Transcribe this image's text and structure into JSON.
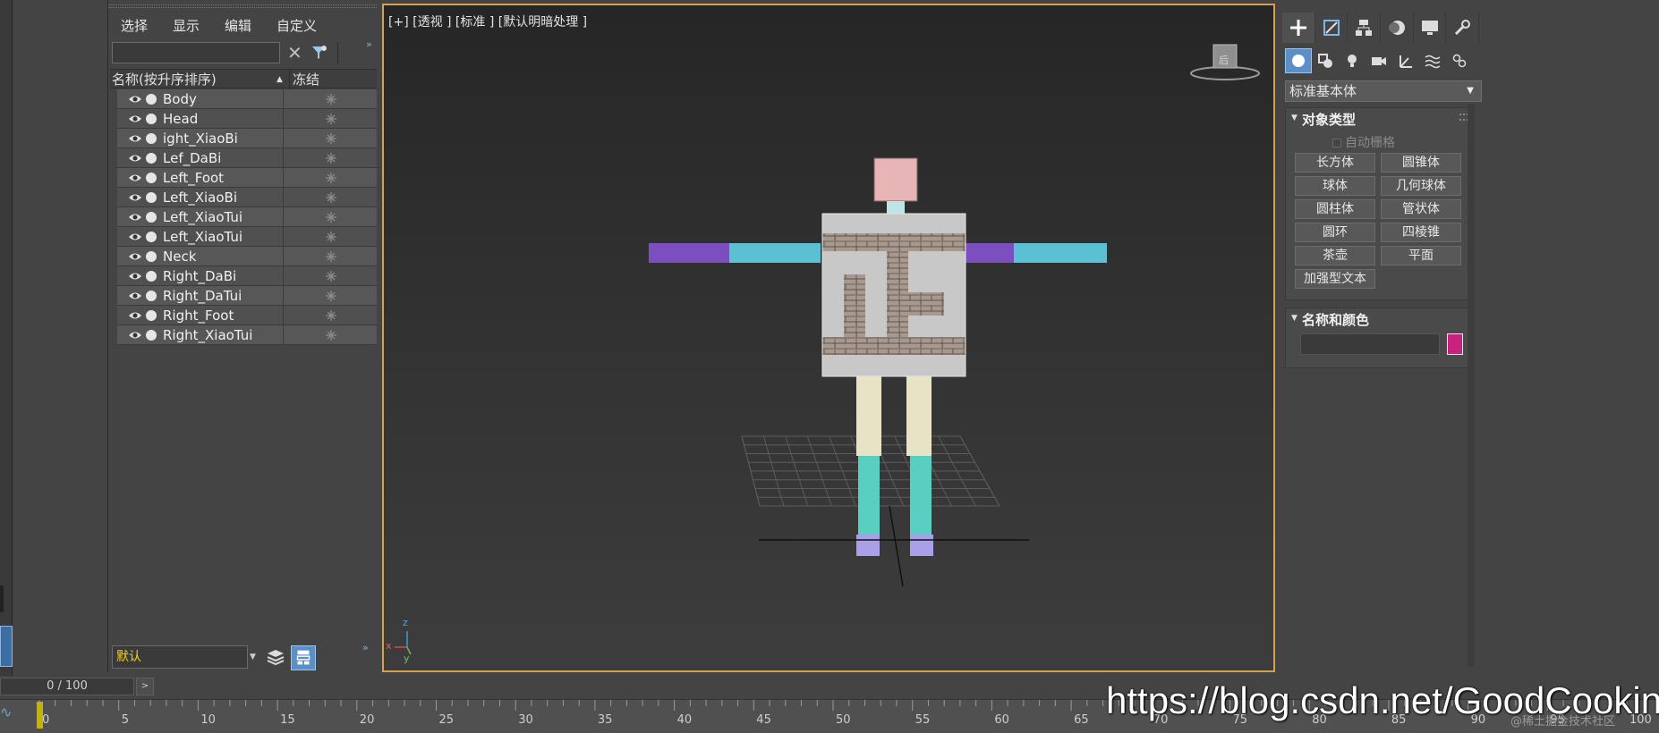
{
  "explorer": {
    "menu": [
      "选择",
      "显示",
      "编辑",
      "自定义"
    ],
    "search_placeholder": "",
    "column_name": "名称(按升序排序)",
    "column_sort": "▲",
    "column_freeze": "冻结",
    "objects": [
      "Body",
      "Head",
      "ight_XiaoBi",
      "Lef_DaBi",
      "Left_Foot",
      "Left_XiaoBi",
      "Left_XiaoTui",
      "Left_XiaoTui",
      "Neck",
      "Right_DaBi",
      "Right_DaTui",
      "Right_Foot",
      "Right_XiaoTui"
    ],
    "layer": "默认"
  },
  "viewport": {
    "label": "[+] [透视 ] [标准 ] [默认明暗处理 ]",
    "viewcube_face": "后",
    "axis_labels": {
      "x": "x",
      "y": "y",
      "z": "z"
    }
  },
  "command_panel": {
    "tab_icons": [
      "plus-icon",
      "modify-icon",
      "hierarchy-icon",
      "motion-icon",
      "display-icon",
      "utilities-icon"
    ],
    "subtab_icons": [
      "geometry-icon",
      "shapes-icon",
      "lights-icon",
      "cameras-icon",
      "helpers-icon",
      "spacewarps-icon",
      "systems-icon"
    ],
    "category": "标准基本体",
    "object_type_title": "对象类型",
    "autogrid": "自动栅格",
    "object_buttons": [
      "长方体",
      "圆锥体",
      "球体",
      "几何球体",
      "圆柱体",
      "管状体",
      "圆环",
      "四棱锥",
      "茶壶",
      "平面",
      "加强型文本"
    ],
    "name_color_title": "名称和颜色",
    "name_value": "",
    "object_color": "#c8227f"
  },
  "timeline": {
    "frame_display": "0 / 100",
    "ticks": [
      "0",
      "5",
      "10",
      "15",
      "20",
      "25",
      "30",
      "35",
      "40",
      "45",
      "50",
      "55",
      "60",
      "65",
      "70",
      "75",
      "80",
      "85",
      "90",
      "95",
      "100"
    ]
  },
  "watermark": {
    "url": "https://blog.csdn.net/GoodCooking",
    "small": "@稀土掘金技术社区"
  }
}
